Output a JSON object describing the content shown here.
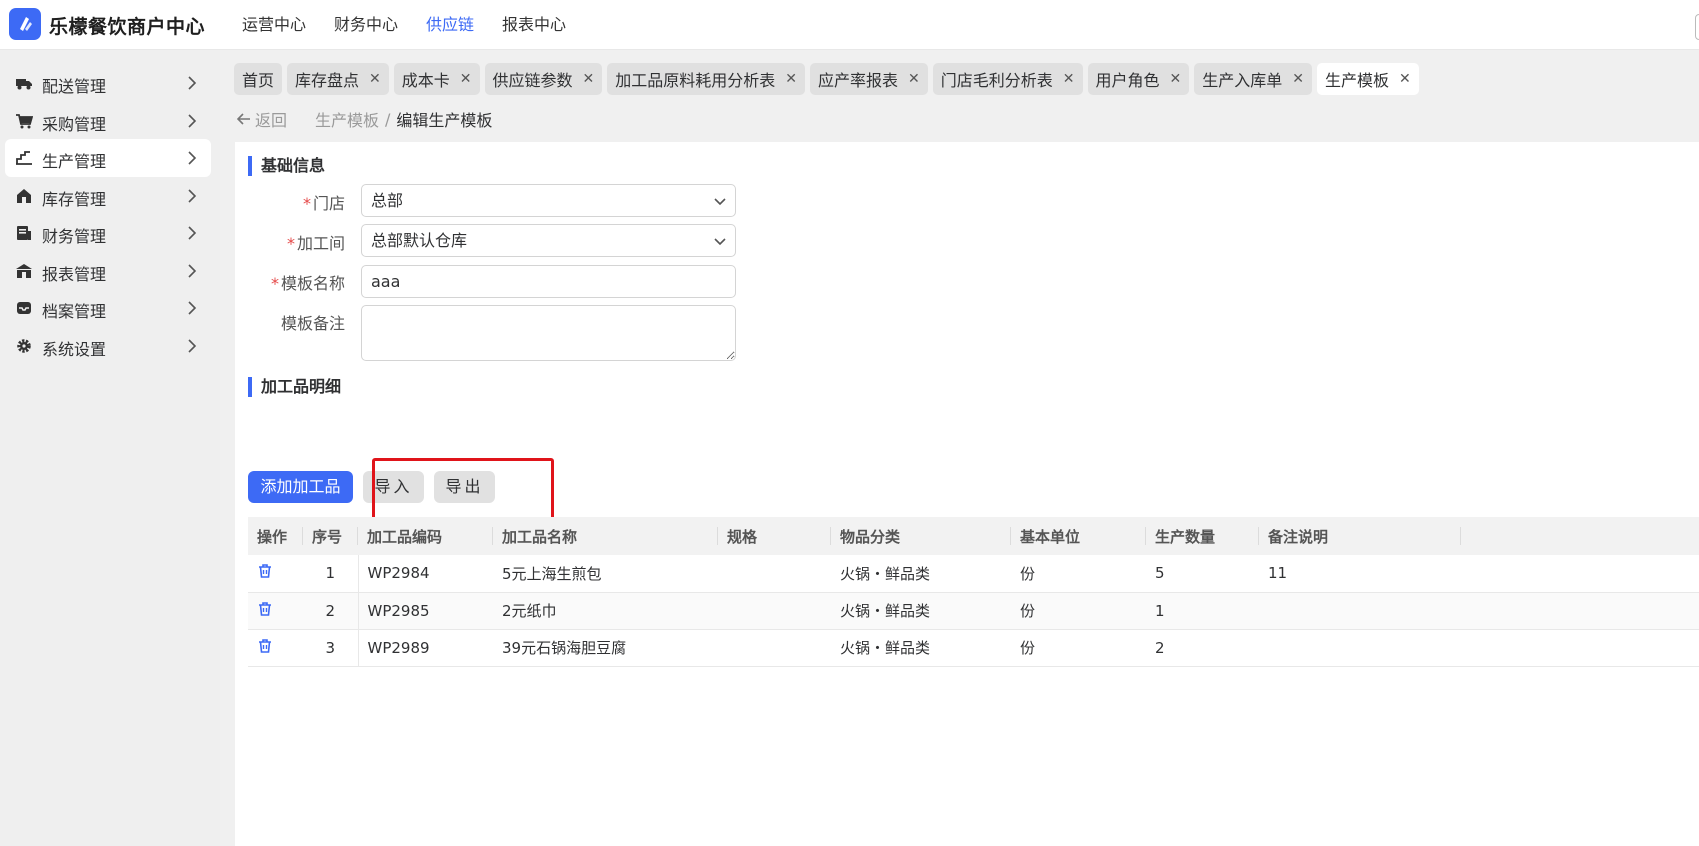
{
  "app": {
    "title": "乐檬餐饮商户中心",
    "accent": "#3d6af5"
  },
  "topnav": [
    {
      "label": "运营中心",
      "active": false
    },
    {
      "label": "财务中心",
      "active": false
    },
    {
      "label": "供应链",
      "active": true
    },
    {
      "label": "报表中心",
      "active": false
    }
  ],
  "sidebar": {
    "items": [
      {
        "label": "配送管理",
        "icon": "truck-icon"
      },
      {
        "label": "采购管理",
        "icon": "cart-icon"
      },
      {
        "label": "生产管理",
        "icon": "production-icon",
        "active": true
      },
      {
        "label": "库存管理",
        "icon": "warehouse-icon"
      },
      {
        "label": "财务管理",
        "icon": "finance-icon"
      },
      {
        "label": "报表管理",
        "icon": "report-icon"
      },
      {
        "label": "档案管理",
        "icon": "archive-icon"
      },
      {
        "label": "系统设置",
        "icon": "gear-icon"
      }
    ]
  },
  "tabs": [
    {
      "label": "首页",
      "closable": false
    },
    {
      "label": "库存盘点",
      "closable": true
    },
    {
      "label": "成本卡",
      "closable": true
    },
    {
      "label": "供应链参数",
      "closable": true
    },
    {
      "label": "加工品原料耗用分析表",
      "closable": true
    },
    {
      "label": "应产率报表",
      "closable": true
    },
    {
      "label": "门店毛利分析表",
      "closable": true
    },
    {
      "label": "用户角色",
      "closable": true
    },
    {
      "label": "生产入库单",
      "closable": true
    },
    {
      "label": "生产模板",
      "closable": true,
      "active": true
    }
  ],
  "breadcrumb": {
    "back": "返回",
    "parent": "生产模板",
    "sep": "/",
    "current": "编辑生产模板"
  },
  "basic": {
    "title": "基础信息",
    "store_label": "门店",
    "store_value": "总部",
    "workshop_label": "加工间",
    "workshop_value": "总部默认仓库",
    "name_label": "模板名称",
    "name_value": "aaa",
    "note_label": "模板备注",
    "note_value": ""
  },
  "detail": {
    "title": "加工品明细",
    "add_button": "添加加工品",
    "import_button": "导入",
    "export_button": "导出",
    "columns": [
      "操作",
      "序号",
      "加工品编码",
      "加工品名称",
      "规格",
      "物品分类",
      "基本单位",
      "生产数量",
      "备注说明",
      ""
    ],
    "rows": [
      {
        "seq": "1",
        "code": "WP2984",
        "name": "5元上海生煎包",
        "spec": "",
        "category": "火锅・鲜品类",
        "unit": "份",
        "qty": "5",
        "note": "11"
      },
      {
        "seq": "2",
        "code": "WP2985",
        "name": "2元纸巾",
        "spec": "",
        "category": "火锅・鲜品类",
        "unit": "份",
        "qty": "1",
        "note": ""
      },
      {
        "seq": "3",
        "code": "WP2989",
        "name": "39元石锅海胆豆腐",
        "spec": "",
        "category": "火锅・鲜品类",
        "unit": "份",
        "qty": "2",
        "note": ""
      }
    ]
  }
}
